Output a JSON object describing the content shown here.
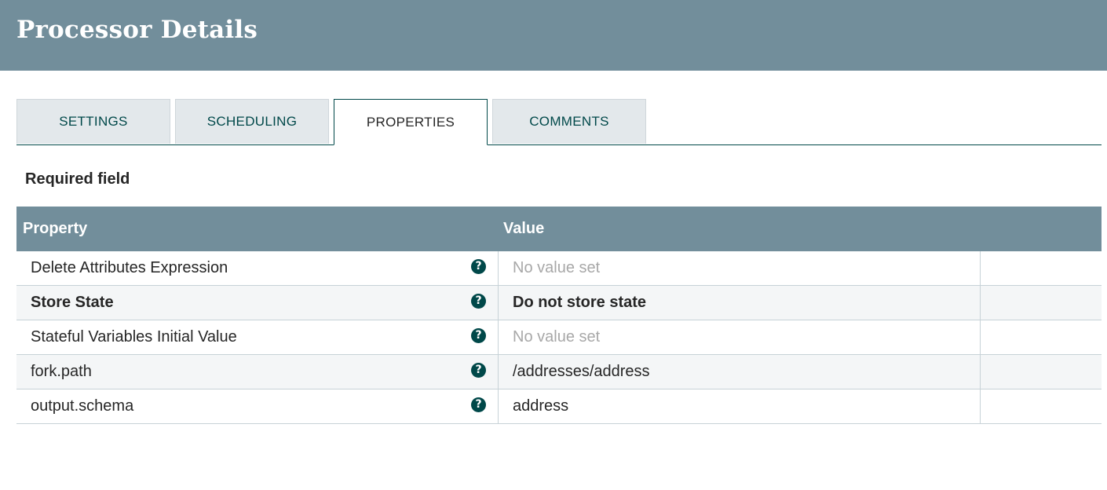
{
  "header": {
    "title": "Processor Details"
  },
  "tabs": [
    {
      "label": "SETTINGS",
      "active": false
    },
    {
      "label": "SCHEDULING",
      "active": false
    },
    {
      "label": "PROPERTIES",
      "active": true
    },
    {
      "label": "COMMENTS",
      "active": false
    }
  ],
  "required_label": "Required field",
  "table": {
    "columns": {
      "property": "Property",
      "value": "Value"
    },
    "rows": [
      {
        "property": "Delete Attributes Expression",
        "value": "No value set",
        "required": false,
        "value_set": false
      },
      {
        "property": "Store State",
        "value": "Do not store state",
        "required": true,
        "value_set": true
      },
      {
        "property": "Stateful Variables Initial Value",
        "value": "No value set",
        "required": false,
        "value_set": false
      },
      {
        "property": "fork.path",
        "value": "/addresses/address",
        "required": false,
        "value_set": true
      },
      {
        "property": "output.schema",
        "value": "address",
        "required": false,
        "value_set": true
      }
    ]
  },
  "colors": {
    "header_bg": "#728e9b",
    "accent": "#004849",
    "placeholder": "#a8a8a8"
  },
  "icons": {
    "help": "question-circle-icon"
  }
}
